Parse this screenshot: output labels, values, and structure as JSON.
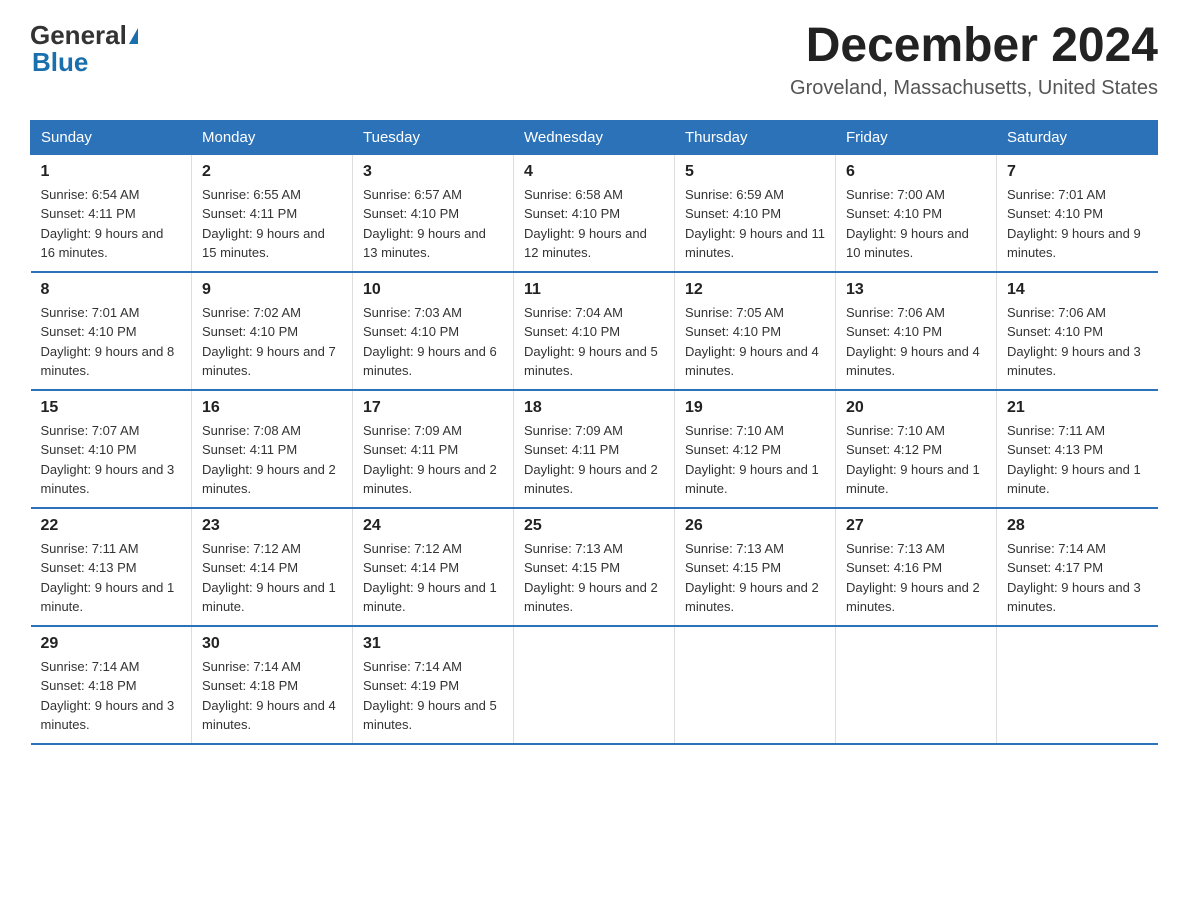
{
  "header": {
    "logo_general": "General",
    "logo_blue": "Blue",
    "month_title": "December 2024",
    "location": "Groveland, Massachusetts, United States"
  },
  "weekdays": [
    "Sunday",
    "Monday",
    "Tuesday",
    "Wednesday",
    "Thursday",
    "Friday",
    "Saturday"
  ],
  "weeks": [
    [
      {
        "day": "1",
        "sunrise": "6:54 AM",
        "sunset": "4:11 PM",
        "daylight": "9 hours and 16 minutes."
      },
      {
        "day": "2",
        "sunrise": "6:55 AM",
        "sunset": "4:11 PM",
        "daylight": "9 hours and 15 minutes."
      },
      {
        "day": "3",
        "sunrise": "6:57 AM",
        "sunset": "4:10 PM",
        "daylight": "9 hours and 13 minutes."
      },
      {
        "day": "4",
        "sunrise": "6:58 AM",
        "sunset": "4:10 PM",
        "daylight": "9 hours and 12 minutes."
      },
      {
        "day": "5",
        "sunrise": "6:59 AM",
        "sunset": "4:10 PM",
        "daylight": "9 hours and 11 minutes."
      },
      {
        "day": "6",
        "sunrise": "7:00 AM",
        "sunset": "4:10 PM",
        "daylight": "9 hours and 10 minutes."
      },
      {
        "day": "7",
        "sunrise": "7:01 AM",
        "sunset": "4:10 PM",
        "daylight": "9 hours and 9 minutes."
      }
    ],
    [
      {
        "day": "8",
        "sunrise": "7:01 AM",
        "sunset": "4:10 PM",
        "daylight": "9 hours and 8 minutes."
      },
      {
        "day": "9",
        "sunrise": "7:02 AM",
        "sunset": "4:10 PM",
        "daylight": "9 hours and 7 minutes."
      },
      {
        "day": "10",
        "sunrise": "7:03 AM",
        "sunset": "4:10 PM",
        "daylight": "9 hours and 6 minutes."
      },
      {
        "day": "11",
        "sunrise": "7:04 AM",
        "sunset": "4:10 PM",
        "daylight": "9 hours and 5 minutes."
      },
      {
        "day": "12",
        "sunrise": "7:05 AM",
        "sunset": "4:10 PM",
        "daylight": "9 hours and 4 minutes."
      },
      {
        "day": "13",
        "sunrise": "7:06 AM",
        "sunset": "4:10 PM",
        "daylight": "9 hours and 4 minutes."
      },
      {
        "day": "14",
        "sunrise": "7:06 AM",
        "sunset": "4:10 PM",
        "daylight": "9 hours and 3 minutes."
      }
    ],
    [
      {
        "day": "15",
        "sunrise": "7:07 AM",
        "sunset": "4:10 PM",
        "daylight": "9 hours and 3 minutes."
      },
      {
        "day": "16",
        "sunrise": "7:08 AM",
        "sunset": "4:11 PM",
        "daylight": "9 hours and 2 minutes."
      },
      {
        "day": "17",
        "sunrise": "7:09 AM",
        "sunset": "4:11 PM",
        "daylight": "9 hours and 2 minutes."
      },
      {
        "day": "18",
        "sunrise": "7:09 AM",
        "sunset": "4:11 PM",
        "daylight": "9 hours and 2 minutes."
      },
      {
        "day": "19",
        "sunrise": "7:10 AM",
        "sunset": "4:12 PM",
        "daylight": "9 hours and 1 minute."
      },
      {
        "day": "20",
        "sunrise": "7:10 AM",
        "sunset": "4:12 PM",
        "daylight": "9 hours and 1 minute."
      },
      {
        "day": "21",
        "sunrise": "7:11 AM",
        "sunset": "4:13 PM",
        "daylight": "9 hours and 1 minute."
      }
    ],
    [
      {
        "day": "22",
        "sunrise": "7:11 AM",
        "sunset": "4:13 PM",
        "daylight": "9 hours and 1 minute."
      },
      {
        "day": "23",
        "sunrise": "7:12 AM",
        "sunset": "4:14 PM",
        "daylight": "9 hours and 1 minute."
      },
      {
        "day": "24",
        "sunrise": "7:12 AM",
        "sunset": "4:14 PM",
        "daylight": "9 hours and 1 minute."
      },
      {
        "day": "25",
        "sunrise": "7:13 AM",
        "sunset": "4:15 PM",
        "daylight": "9 hours and 2 minutes."
      },
      {
        "day": "26",
        "sunrise": "7:13 AM",
        "sunset": "4:15 PM",
        "daylight": "9 hours and 2 minutes."
      },
      {
        "day": "27",
        "sunrise": "7:13 AM",
        "sunset": "4:16 PM",
        "daylight": "9 hours and 2 minutes."
      },
      {
        "day": "28",
        "sunrise": "7:14 AM",
        "sunset": "4:17 PM",
        "daylight": "9 hours and 3 minutes."
      }
    ],
    [
      {
        "day": "29",
        "sunrise": "7:14 AM",
        "sunset": "4:18 PM",
        "daylight": "9 hours and 3 minutes."
      },
      {
        "day": "30",
        "sunrise": "7:14 AM",
        "sunset": "4:18 PM",
        "daylight": "9 hours and 4 minutes."
      },
      {
        "day": "31",
        "sunrise": "7:14 AM",
        "sunset": "4:19 PM",
        "daylight": "9 hours and 5 minutes."
      },
      null,
      null,
      null,
      null
    ]
  ]
}
